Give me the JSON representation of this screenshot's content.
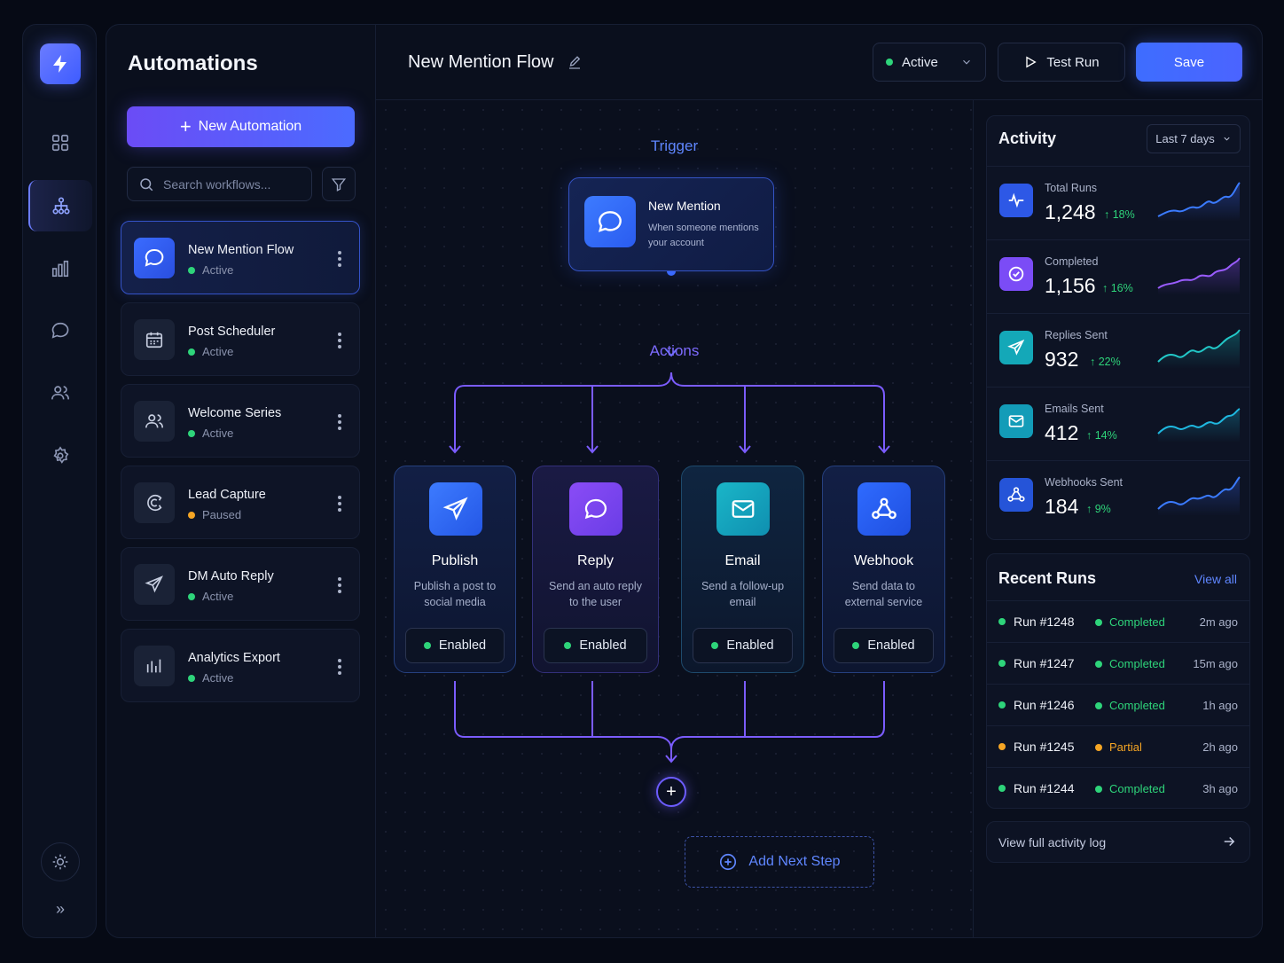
{
  "sidebar": {
    "title": "Automations",
    "new_button": "New Automation",
    "search_placeholder": "Search workflows...",
    "workflows": [
      {
        "name": "New Mention Flow",
        "status": "Active",
        "icon": "chat-bubble-icon",
        "active": true
      },
      {
        "name": "Post Scheduler",
        "status": "Active",
        "icon": "calendar-icon"
      },
      {
        "name": "Welcome Series",
        "status": "Active",
        "icon": "users-icon"
      },
      {
        "name": "Lead Capture",
        "status": "Paused",
        "icon": "magnet-icon"
      },
      {
        "name": "DM Auto Reply",
        "status": "Active",
        "icon": "send-icon"
      },
      {
        "name": "Analytics Export",
        "status": "Active",
        "icon": "bar-chart-icon"
      }
    ]
  },
  "header": {
    "flow_title": "New Mention Flow",
    "status_select": "Active",
    "test_run": "Test Run",
    "save": "Save"
  },
  "canvas": {
    "trigger_label": "Trigger",
    "actions_label": "Actions",
    "trigger": {
      "name": "New Mention",
      "description": "When someone mentions your account"
    },
    "actions": [
      {
        "name": "Publish",
        "description": "Publish a post to social media",
        "status": "Enabled",
        "icon": "send-icon"
      },
      {
        "name": "Reply",
        "description": "Send an auto reply to the user",
        "status": "Enabled",
        "icon": "chat-bubble-icon"
      },
      {
        "name": "Email",
        "description": "Send a follow-up email",
        "status": "Enabled",
        "icon": "mail-icon"
      },
      {
        "name": "Webhook",
        "description": "Send data to external service",
        "status": "Enabled",
        "icon": "webhook-icon"
      }
    ],
    "add_next_step": "Add Next Step"
  },
  "activity": {
    "title": "Activity",
    "range": "Last 7 days",
    "stats": [
      {
        "label": "Total Runs",
        "value": "1,248",
        "change": "18%",
        "color": "#3b6bff"
      },
      {
        "label": "Completed",
        "value": "1,156",
        "change": "16%",
        "color": "#7b4cf6"
      },
      {
        "label": "Replies Sent",
        "value": "932",
        "change": "22%",
        "color": "#14b8c4"
      },
      {
        "label": "Emails Sent",
        "value": "412",
        "change": "14%",
        "color": "#17a9c8"
      },
      {
        "label": "Webhooks Sent",
        "value": "184",
        "change": "9%",
        "color": "#2e5de8"
      }
    ]
  },
  "recent_runs": {
    "title": "Recent Runs",
    "view_all": "View all",
    "runs": [
      {
        "id": "Run #1248",
        "status": "Completed",
        "time": "2m ago"
      },
      {
        "id": "Run #1247",
        "status": "Completed",
        "time": "15m ago"
      },
      {
        "id": "Run #1246",
        "status": "Completed",
        "time": "1h ago"
      },
      {
        "id": "Run #1245",
        "status": "Partial",
        "time": "2h ago"
      },
      {
        "id": "Run #1244",
        "status": "Completed",
        "time": "3h ago"
      }
    ],
    "full_log": "View full activity log"
  },
  "colors": {
    "accent": "#4b6bff",
    "success": "#2ed47a",
    "warning": "#f5a524"
  }
}
